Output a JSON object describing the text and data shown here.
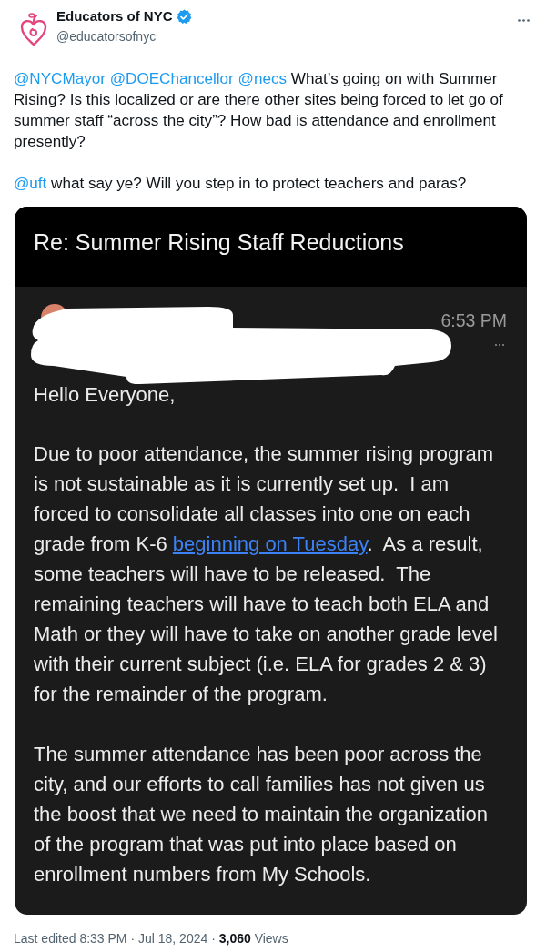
{
  "author": {
    "name": "Educators of NYC",
    "handle": "@educatorsofnyc",
    "verified": true
  },
  "tweet": {
    "paragraphs": [
      {
        "mentions": [
          "@NYCMayor",
          "@DOEChancellor",
          "@necs"
        ],
        "text": "What’s going on with Summer Rising? Is this localized or are there other sites being forced to let go of summer staff “across the city”? How bad is attendance and enrollment presently?"
      },
      {
        "mentions": [
          "@uft"
        ],
        "text": "what say ye? Will you step in to protect teachers and paras?"
      }
    ]
  },
  "email": {
    "subject": "Re: Summer Rising Staff Reductions",
    "time": "6:53 PM",
    "greeting": "Hello Everyone,",
    "paragraphs": [
      [
        {
          "kind": "text",
          "text": "Due to poor attendance, the summer rising program is not sustainable as it is currently set up.  I am forced to consolidate all classes into one on each grade from K-6 "
        },
        {
          "kind": "link",
          "text": "beginning on Tuesday"
        },
        {
          "kind": "text",
          "text": ".  As a result, some teachers will have to be released.  The remaining teachers will have to teach both ELA and Math or they will have to take on another grade level with their current subject (i.e. ELA for grades 2 & 3) for the remainder of the program."
        }
      ],
      [
        {
          "kind": "text",
          "text": "The summer attendance has been poor across the city, and our efforts to call families has not given us the boost that we need to maintain the organization of the program that was put into place based on enrollment numbers from My Schools."
        }
      ]
    ]
  },
  "footer": "Last edited 8:33 PM · Jul 18, 2024 · **3,060** Views"
}
